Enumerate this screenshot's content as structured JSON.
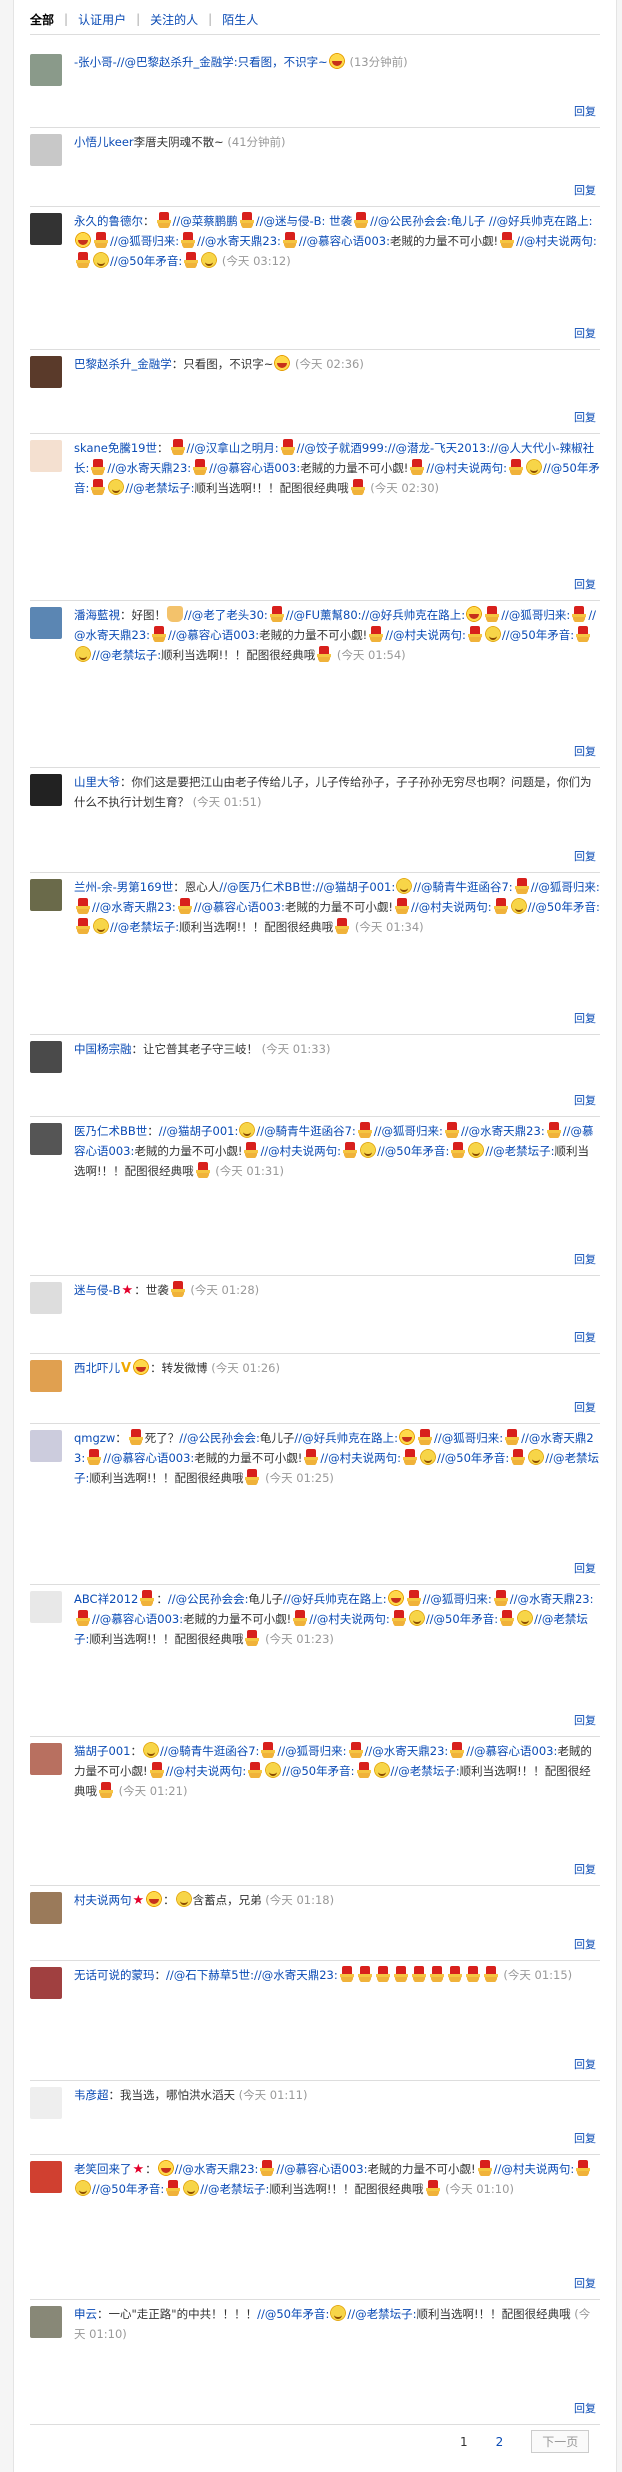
{
  "tabs": {
    "all": "全部",
    "verified": "认证用户",
    "following": "关注的人",
    "strangers": "陌生人"
  },
  "reply_label": "回复",
  "colors": {
    "link": "#0a4bb5",
    "time": "#999999",
    "divider": "#dddddd"
  },
  "comments": [
    {
      "user": "-张小哥-",
      "parts": [
        "rt",
        "//@巴黎赵杀升_金融学:只看图，不识字~",
        "emo:laugh"
      ],
      "time": "(13分钟前)"
    },
    {
      "user": "小悟儿keer",
      "parts": [
        "txt",
        "李厝夫阴魂不散~"
      ],
      "time": "(41分钟前)"
    },
    {
      "user": "永久的鲁德尔",
      "parts": [
        "txt",
        "：",
        "emo:hat",
        "rt",
        "//@菜蔡鹏鹏",
        "emo:hat",
        "rt",
        "//@迷与侵-B: 世袭",
        "emo:hat",
        "rt",
        "//@公民孙会会:龟儿子 //@好兵帅克在路上:",
        "emo:laugh",
        "emo:hat",
        "rt",
        "//@狐哥归来:",
        "emo:hat",
        "rt",
        "//@水寄天鼎23:",
        "emo:hat",
        "rt",
        "//@慕容心语003:",
        "txt",
        "老賊的力量不可小觑!",
        "emo:hat",
        "rt",
        "//@村夫说两句:",
        "emo:hat",
        "emo:face",
        "rt",
        "//@50年矛音:",
        "emo:hat",
        "emo:face"
      ],
      "time": "(今天 03:12)"
    },
    {
      "user": "巴黎赵杀升_金融学",
      "parts": [
        "txt",
        "：只看图，不识字~",
        "emo:laugh"
      ],
      "time": "(今天 02:36)"
    },
    {
      "user": "skane免騰19世",
      "parts": [
        "txt",
        "：",
        "emo:hat",
        "rt",
        "//@汉拿山之明月:",
        "emo:hat",
        "rt",
        "//@饺子就酒999://@潜龙-飞天2013://@人大代小-辣椒社长:",
        "emo:hat",
        "rt",
        "//@水寄天鼎23:",
        "emo:hat",
        "rt",
        "//@慕容心语003:",
        "txt",
        "老賊的力量不可小觑!",
        "emo:hat",
        "rt",
        "//@村夫说两句:",
        "emo:hat",
        "emo:face",
        "rt",
        "//@50年矛音:",
        "emo:hat",
        "emo:face",
        "rt",
        "//@老禁坛子:",
        "txt",
        "顺利当选啊!！！配图很经典哦",
        "emo:hat"
      ],
      "time": "(今天 02:30)"
    },
    {
      "user": "潘海藍視",
      "parts": [
        "txt",
        "：好图！",
        "emo:thumb",
        "rt",
        "//@老了老头30:",
        "emo:hat",
        "rt",
        "//@FU薰幫80://@好兵帅克在路上:",
        "emo:laugh",
        "emo:hat",
        "rt",
        "//@狐哥归来:",
        "emo:hat",
        "rt",
        "//@水寄天鼎23:",
        "emo:hat",
        "rt",
        "//@慕容心语003:",
        "txt",
        "老賊的力量不可小觑!",
        "emo:hat",
        "rt",
        "//@村夫说两句:",
        "emo:hat",
        "emo:face",
        "rt",
        "//@50年矛音:",
        "emo:hat",
        "emo:face",
        "rt",
        "//@老禁坛子:",
        "txt",
        "顺利当选啊!！！配图很经典哦",
        "emo:hat"
      ],
      "time": "(今天 01:54)"
    },
    {
      "user": "山里大爷",
      "parts": [
        "txt",
        "：你们这是要把江山由老子传给儿子，儿子传给孙子，子子孙孙无穷尽也啊？问题是，你们为什么不执行计划生育？"
      ],
      "time": "(今天 01:51)"
    },
    {
      "user": "兰州-余-男第169世",
      "parts": [
        "txt",
        "：恩心人",
        "rt",
        "//@医乃仁术BB世:",
        "rt",
        "//@猫胡子001:",
        "emo:face",
        "rt",
        "//@騎青牛逛函谷7:",
        "emo:hat",
        "rt",
        "//@狐哥归来:",
        "emo:hat",
        "rt",
        "//@水寄天鼎23:",
        "emo:hat",
        "rt",
        "//@慕容心语003:",
        "txt",
        "老賊的力量不可小觑!",
        "emo:hat",
        "rt",
        "//@村夫说两句:",
        "emo:hat",
        "emo:face",
        "rt",
        "//@50年矛音:",
        "emo:hat",
        "emo:face",
        "rt",
        "//@老禁坛子:",
        "txt",
        "顺利当选啊!！！配图很经典哦",
        "emo:hat"
      ],
      "time": "(今天 01:34)"
    },
    {
      "user": "中国杨宗融",
      "parts": [
        "txt",
        "：让它普其老子守三岐！"
      ],
      "time": "(今天 01:33)"
    },
    {
      "user": "医乃仁术BB世",
      "parts": [
        "txt",
        "：",
        "rt",
        "//@猫胡子001:",
        "emo:face",
        "rt",
        "//@騎青牛逛函谷7:",
        "emo:hat",
        "rt",
        "//@狐哥归来:",
        "emo:hat",
        "rt",
        "//@水寄天鼎23:",
        "emo:hat",
        "rt",
        "//@慕容心语003:",
        "txt",
        "老賊的力量不可小觑!",
        "emo:hat",
        "rt",
        "//@村夫说两句:",
        "emo:hat",
        "emo:face",
        "rt",
        "//@50年矛音:",
        "emo:hat",
        "emo:face",
        "rt",
        "//@老禁坛子:",
        "txt",
        "顺利当选啊!！！配图很经典哦",
        "emo:hat"
      ],
      "time": "(今天 01:31)"
    },
    {
      "user": "迷与侵-B",
      "parts": [
        "emo:star",
        "txt",
        "：世袭",
        "emo:hat"
      ],
      "time": "(今天 01:28)"
    },
    {
      "user": "西北吓儿",
      "parts": [
        "emo:v",
        "emo:laugh",
        "txt",
        "：转发微博"
      ],
      "time": "(今天 01:26)"
    },
    {
      "user": "qmgzw",
      "parts": [
        "txt",
        "：",
        "emo:hat",
        "txt",
        "死了？",
        "rt",
        "//@公民孙会会:",
        "txt",
        "龟儿子",
        "rt",
        "//@好兵帅克在路上:",
        "emo:laugh",
        "emo:hat",
        "rt",
        "//@狐哥归来:",
        "emo:hat",
        "rt",
        "//@水寄天鼎23:",
        "emo:hat",
        "rt",
        "//@慕容心语003:",
        "txt",
        "老賊的力量不可小觑!",
        "emo:hat",
        "rt",
        "//@村夫说两句:",
        "emo:hat",
        "emo:face",
        "rt",
        "//@50年矛音:",
        "emo:hat",
        "emo:face",
        "rt",
        "//@老禁坛子:",
        "txt",
        "顺利当选啊!！！配图很经典哦",
        "emo:hat"
      ],
      "time": "(今天 01:25)"
    },
    {
      "user": "ABC祥2012",
      "parts": [
        "emo:hat",
        "txt",
        "：",
        "rt",
        "//@公民孙会会:",
        "txt",
        "龟儿子",
        "rt",
        "//@好兵帅克在路上:",
        "emo:laugh",
        "emo:hat",
        "rt",
        "//@狐哥归来:",
        "emo:hat",
        "rt",
        "//@水寄天鼎23:",
        "emo:hat",
        "rt",
        "//@慕容心语003:",
        "txt",
        "老賊的力量不可小觑!",
        "emo:hat",
        "rt",
        "//@村夫说两句:",
        "emo:hat",
        "emo:face",
        "rt",
        "//@50年矛音:",
        "emo:hat",
        "emo:face",
        "rt",
        "//@老禁坛子:",
        "txt",
        "顺利当选啊!！！配图很经典哦",
        "emo:hat"
      ],
      "time": "(今天 01:23)"
    },
    {
      "user": "猫胡子001",
      "parts": [
        "txt",
        "：",
        "emo:face",
        "rt",
        "//@騎青牛逛函谷7:",
        "emo:hat",
        "rt",
        "//@狐哥归来:",
        "emo:hat",
        "rt",
        "//@水寄天鼎23:",
        "emo:hat",
        "rt",
        "//@慕容心语003:",
        "txt",
        "老賊的力量不可小觑!",
        "emo:hat",
        "rt",
        "//@村夫说两句:",
        "emo:hat",
        "emo:face",
        "rt",
        "//@50年矛音:",
        "emo:hat",
        "emo:face",
        "rt",
        "//@老禁坛子:",
        "txt",
        "顺利当选啊!！！配图很经典哦",
        "emo:hat"
      ],
      "time": "(今天 01:21)"
    },
    {
      "user": "村夫说两句",
      "parts": [
        "emo:star",
        "emo:laugh",
        "txt",
        "：",
        "emo:face",
        "txt",
        "含蓄点，兄弟"
      ],
      "time": "(今天 01:18)"
    },
    {
      "user": "无话可说的蒙玛",
      "parts": [
        "txt",
        "：",
        "rt",
        "//@石下赫草5世:",
        "rt",
        "//@水寄天鼎23:",
        "emo:hat",
        "emo:hat",
        "emo:hat",
        "emo:hat",
        "emo:hat",
        "emo:hat",
        "emo:hat",
        "emo:hat",
        "emo:hat"
      ],
      "time": "(今天 01:15)"
    },
    {
      "user": "韦彦超",
      "parts": [
        "txt",
        "：我当选，哪怕洪水滔天"
      ],
      "time": "(今天 01:11)"
    },
    {
      "user": "老笑回来了",
      "parts": [
        "emo:star",
        "txt",
        "：",
        "emo:laugh",
        "rt",
        "//@水寄天鼎23:",
        "emo:hat",
        "rt",
        "//@慕容心语003:",
        "txt",
        "老賊的力量不可小觑!",
        "emo:hat",
        "rt",
        "//@村夫说两句:",
        "emo:hat",
        "emo:face",
        "rt",
        "//@50年矛音:",
        "emo:hat",
        "emo:face",
        "rt",
        "//@老禁坛子:",
        "txt",
        "顺利当选啊!！！配图很经典哦",
        "emo:hat"
      ],
      "time": "(今天 01:10)"
    },
    {
      "user": "申云",
      "parts": [
        "txt",
        "：一心\"走正路\"的中共！！！！",
        "rt",
        "//@50年矛音:",
        "emo:face",
        "rt",
        "//@老禁坛子:",
        "txt",
        "顺利当选啊!！！配图很经典哦"
      ],
      "time": "(今天 01:10)"
    }
  ],
  "pager": {
    "p1": "1",
    "p2": "2",
    "next": "下一页"
  }
}
